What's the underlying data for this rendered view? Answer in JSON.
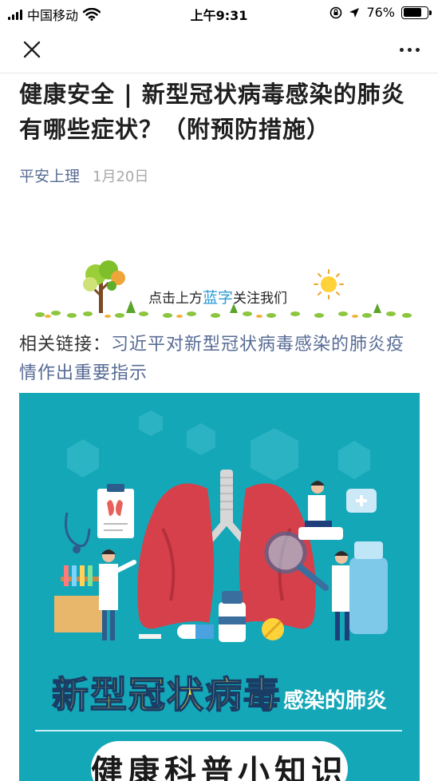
{
  "status_bar": {
    "carrier": "中国移动",
    "time": "上午9:31",
    "battery": "76%",
    "battery_level": 0.76
  },
  "nav": {
    "close_icon": "close-icon",
    "more_icon": "more-icon"
  },
  "article": {
    "title": "健康安全 | 新型冠状病毒感染的肺炎有哪些症状？（附预防措施）",
    "author": "平安上理",
    "date": "1月20日"
  },
  "banner": {
    "text_before": "点击上方",
    "text_blue": "蓝字",
    "text_after": "关注我们"
  },
  "related": {
    "label": "相关链接：",
    "link": "习近平对新型冠状病毒感染的肺炎疫情作出重要指示"
  },
  "poster": {
    "title_big": "新型冠状病毒",
    "title_small": "感染的肺炎",
    "subtitle": "健康科普小知识",
    "bg_color": "#14a7b8"
  }
}
